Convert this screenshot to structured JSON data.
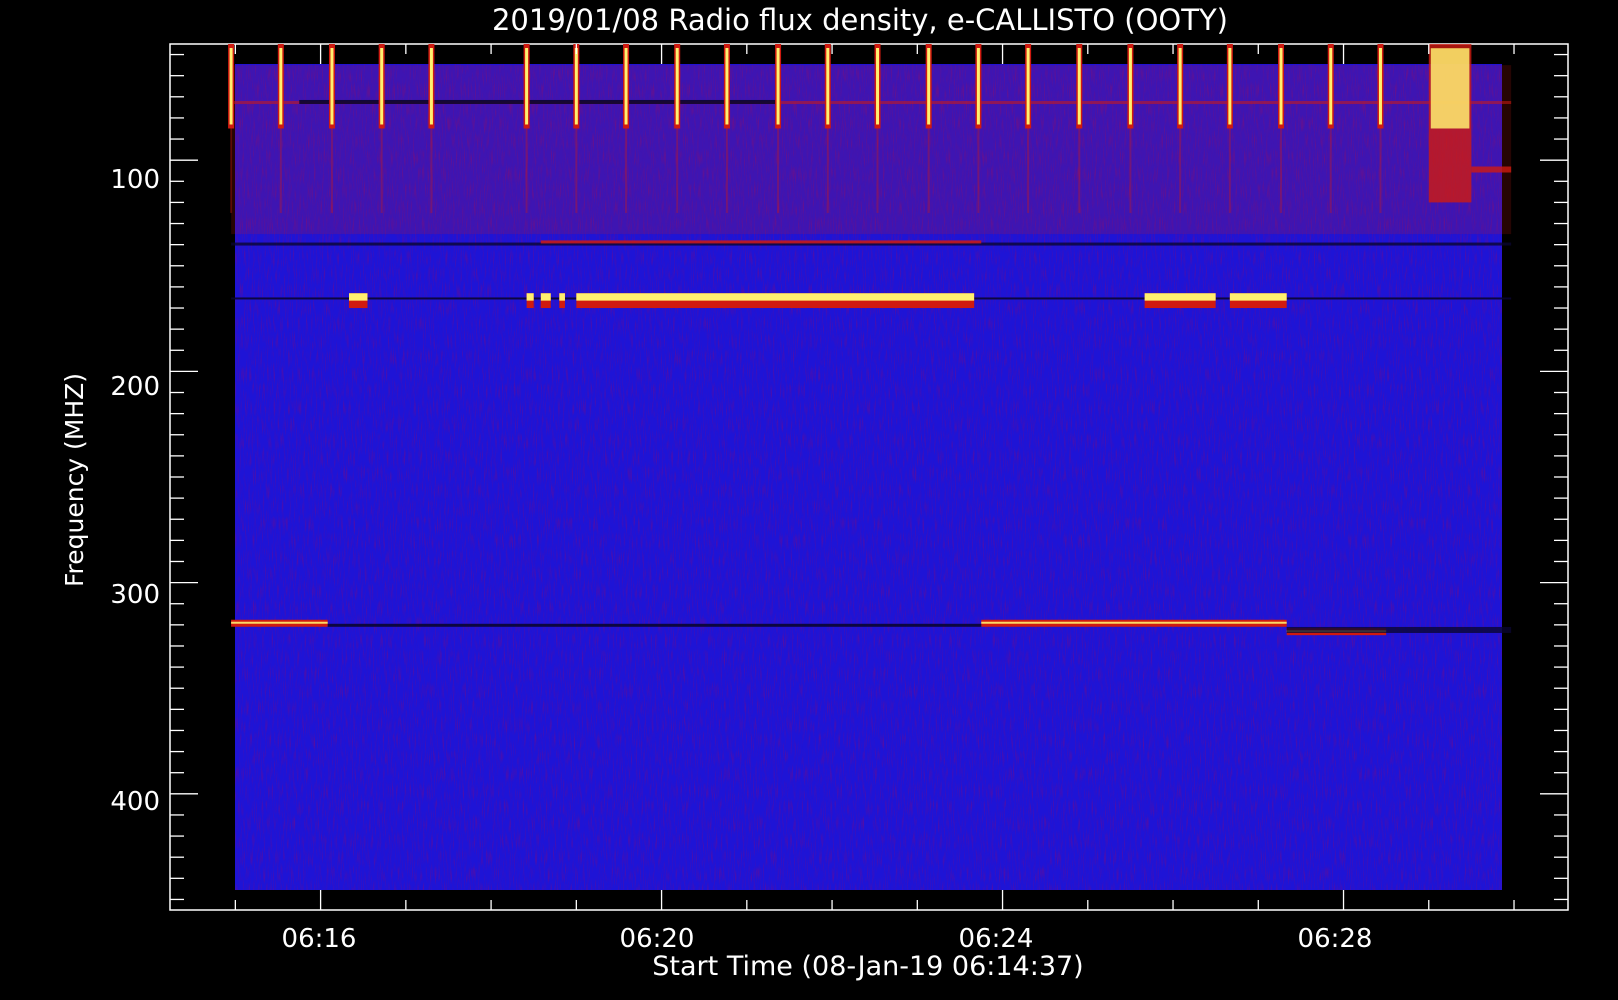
{
  "chart_data": {
    "type": "heatmap",
    "title": "2019/01/08  Radio flux density, e-CALLISTO (OOTY)",
    "xlabel": "Start Time (08-Jan-19 06:14:37)",
    "ylabel": "Frequency (MHZ)",
    "x_range_minutes": [
      "06:14:14",
      "06:30:38"
    ],
    "x_data_range": [
      "06:14:57",
      "06:29:58"
    ],
    "ylim": [
      45,
      455
    ],
    "y_data_range": [
      45,
      445
    ],
    "y_reversed": true,
    "x_tick_labels": [
      "06:16",
      "06:20",
      "06:24",
      "06:28"
    ],
    "y_tick_labels": [
      "100",
      "200",
      "300",
      "400"
    ],
    "colors": {
      "background": "#000000",
      "axes": "#ffffff",
      "low": "#1a10c8",
      "mid": "#2828e6",
      "high_red": "#d01a10",
      "peak_yellow": "#fff070",
      "dark": "#0a0630"
    },
    "features": {
      "periodic_bursts": {
        "freq_range_mhz": [
          45,
          85
        ],
        "times": [
          "06:14:57",
          "06:15:32",
          "06:16:08",
          "06:16:43",
          "06:17:18",
          "06:18:25",
          "06:19:00",
          "06:19:35",
          "06:20:11",
          "06:20:46",
          "06:21:22",
          "06:21:57",
          "06:22:32",
          "06:23:08",
          "06:23:43",
          "06:24:18",
          "06:24:54",
          "06:25:30",
          "06:26:05",
          "06:26:40",
          "06:27:16",
          "06:27:51",
          "06:28:26"
        ]
      },
      "strong_burst": {
        "time_range": [
          "06:29:00",
          "06:29:30"
        ],
        "freq_range_mhz": [
          45,
          120
        ]
      },
      "band_165mhz_segments": [
        [
          "06:16:20",
          "06:16:33"
        ],
        [
          "06:18:25",
          "06:18:30"
        ],
        [
          "06:18:35",
          "06:18:42"
        ],
        [
          "06:18:48",
          "06:18:52"
        ],
        [
          "06:19:00",
          "06:23:40"
        ],
        [
          "06:25:40",
          "06:26:30"
        ],
        [
          "06:26:40",
          "06:27:20"
        ]
      ],
      "band_320mhz_segments": [
        {
          "time_range": [
            "06:14:57",
            "06:16:05"
          ],
          "freq_mhz": 319
        },
        {
          "time_range": [
            "06:23:45",
            "06:27:20"
          ],
          "freq_mhz": 319
        },
        {
          "time_range": [
            "06:27:20",
            "06:28:30"
          ],
          "freq_mhz": 323
        }
      ]
    }
  }
}
